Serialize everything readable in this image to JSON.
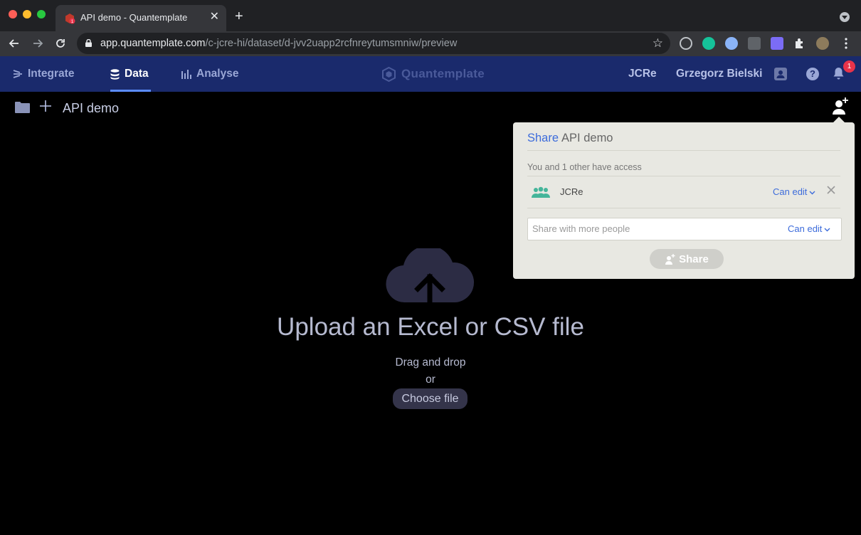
{
  "browser": {
    "tab_title": "API demo - Quantemplate",
    "tab_close": "✕",
    "new_tab": "+",
    "url_host": "app.quantemplate.com",
    "url_path": "/c-jcre-hi/dataset/d-jvv2uapp2rcfnreytumsmniw/preview"
  },
  "nav": {
    "integrate": "Integrate",
    "data": "Data",
    "analyse": "Analyse",
    "brand": "Quantemplate",
    "org": "JCRe",
    "user": "Grzegorz Bielski",
    "help": "?",
    "notifications": "1"
  },
  "subheader": {
    "dataset_name": "API demo"
  },
  "share": {
    "title_label": "Share",
    "title_name": "API demo",
    "access_text": "You and 1 other have access",
    "member_name": "JCRe",
    "member_permission": "Can edit",
    "input_placeholder": "Share with more people",
    "input_permission": "Can edit",
    "button": "Share"
  },
  "upload": {
    "title": "Upload an Excel or CSV file",
    "drag": "Drag and drop",
    "or": "or",
    "choose": "Choose file"
  },
  "colors": {
    "appbar": "#1a2a6c",
    "accent": "#3d6cdb",
    "badge": "#e8334a"
  }
}
